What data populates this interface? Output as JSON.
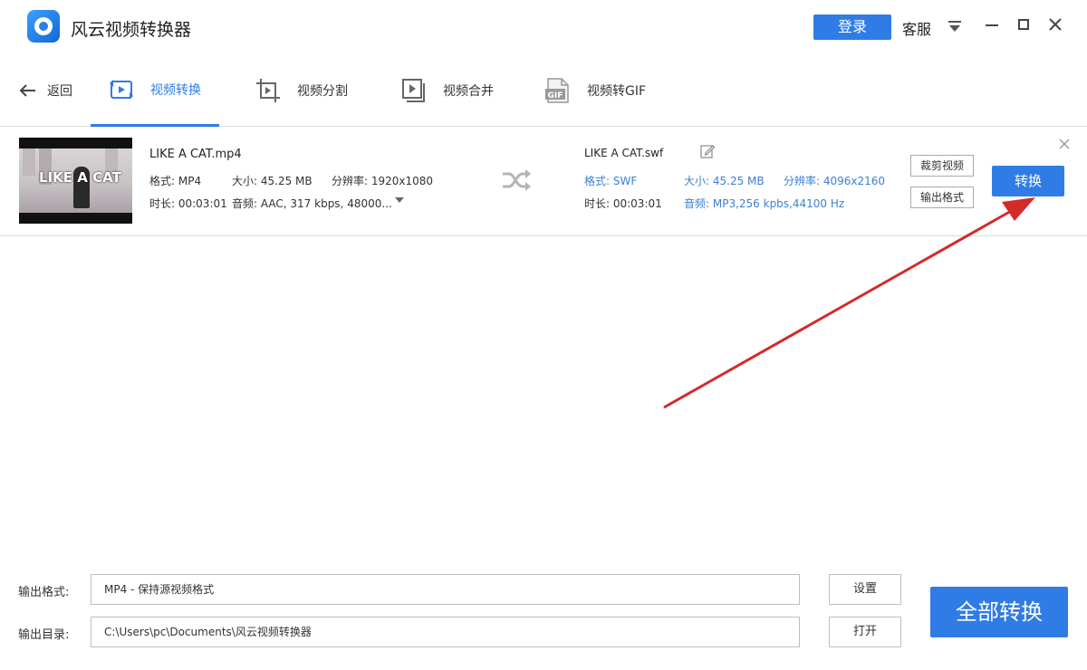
{
  "app": {
    "title": "风云视频转换器",
    "login_label": "登录",
    "service_label": "客服",
    "accent_color": "#2f7ce6"
  },
  "nav": {
    "back_label": "返回",
    "tabs": [
      {
        "label": "视频转换",
        "icon": "video-convert-icon",
        "active": true
      },
      {
        "label": "视频分割",
        "icon": "crop-icon",
        "active": false
      },
      {
        "label": "视频合并",
        "icon": "video-merge-icon",
        "active": false
      },
      {
        "label": "视频转GIF",
        "icon": "gif-icon",
        "active": false
      }
    ]
  },
  "file": {
    "thumbnail_text": "LIKE A CAT",
    "source": {
      "name": "LIKE A CAT.mp4",
      "format": "格式: MP4",
      "size": "大小: 45.25 MB",
      "resolution": "分辨率: 1920x1080",
      "duration": "时长: 00:03:01",
      "audio": "音频: AAC, 317 kbps, 48000..."
    },
    "output": {
      "name": "LIKE A CAT.swf",
      "format": "格式: SWF",
      "size": "大小: 45.25 MB",
      "resolution": "分辨率: 4096x2160",
      "duration": "时长: 00:03:01",
      "audio": "音频: MP3,256 kpbs,44100 Hz"
    },
    "crop_label": "裁剪视频",
    "output_format_label": "输出格式",
    "convert_label": "转换"
  },
  "bottom": {
    "format_label": "输出格式:",
    "format_value": "MP4 - 保持源视频格式",
    "settings_label": "设置",
    "dir_label": "输出目录:",
    "dir_value": "C:\\Users\\pc\\Documents\\风云视频转换器",
    "open_label": "打开",
    "convert_all_label": "全部转换"
  }
}
